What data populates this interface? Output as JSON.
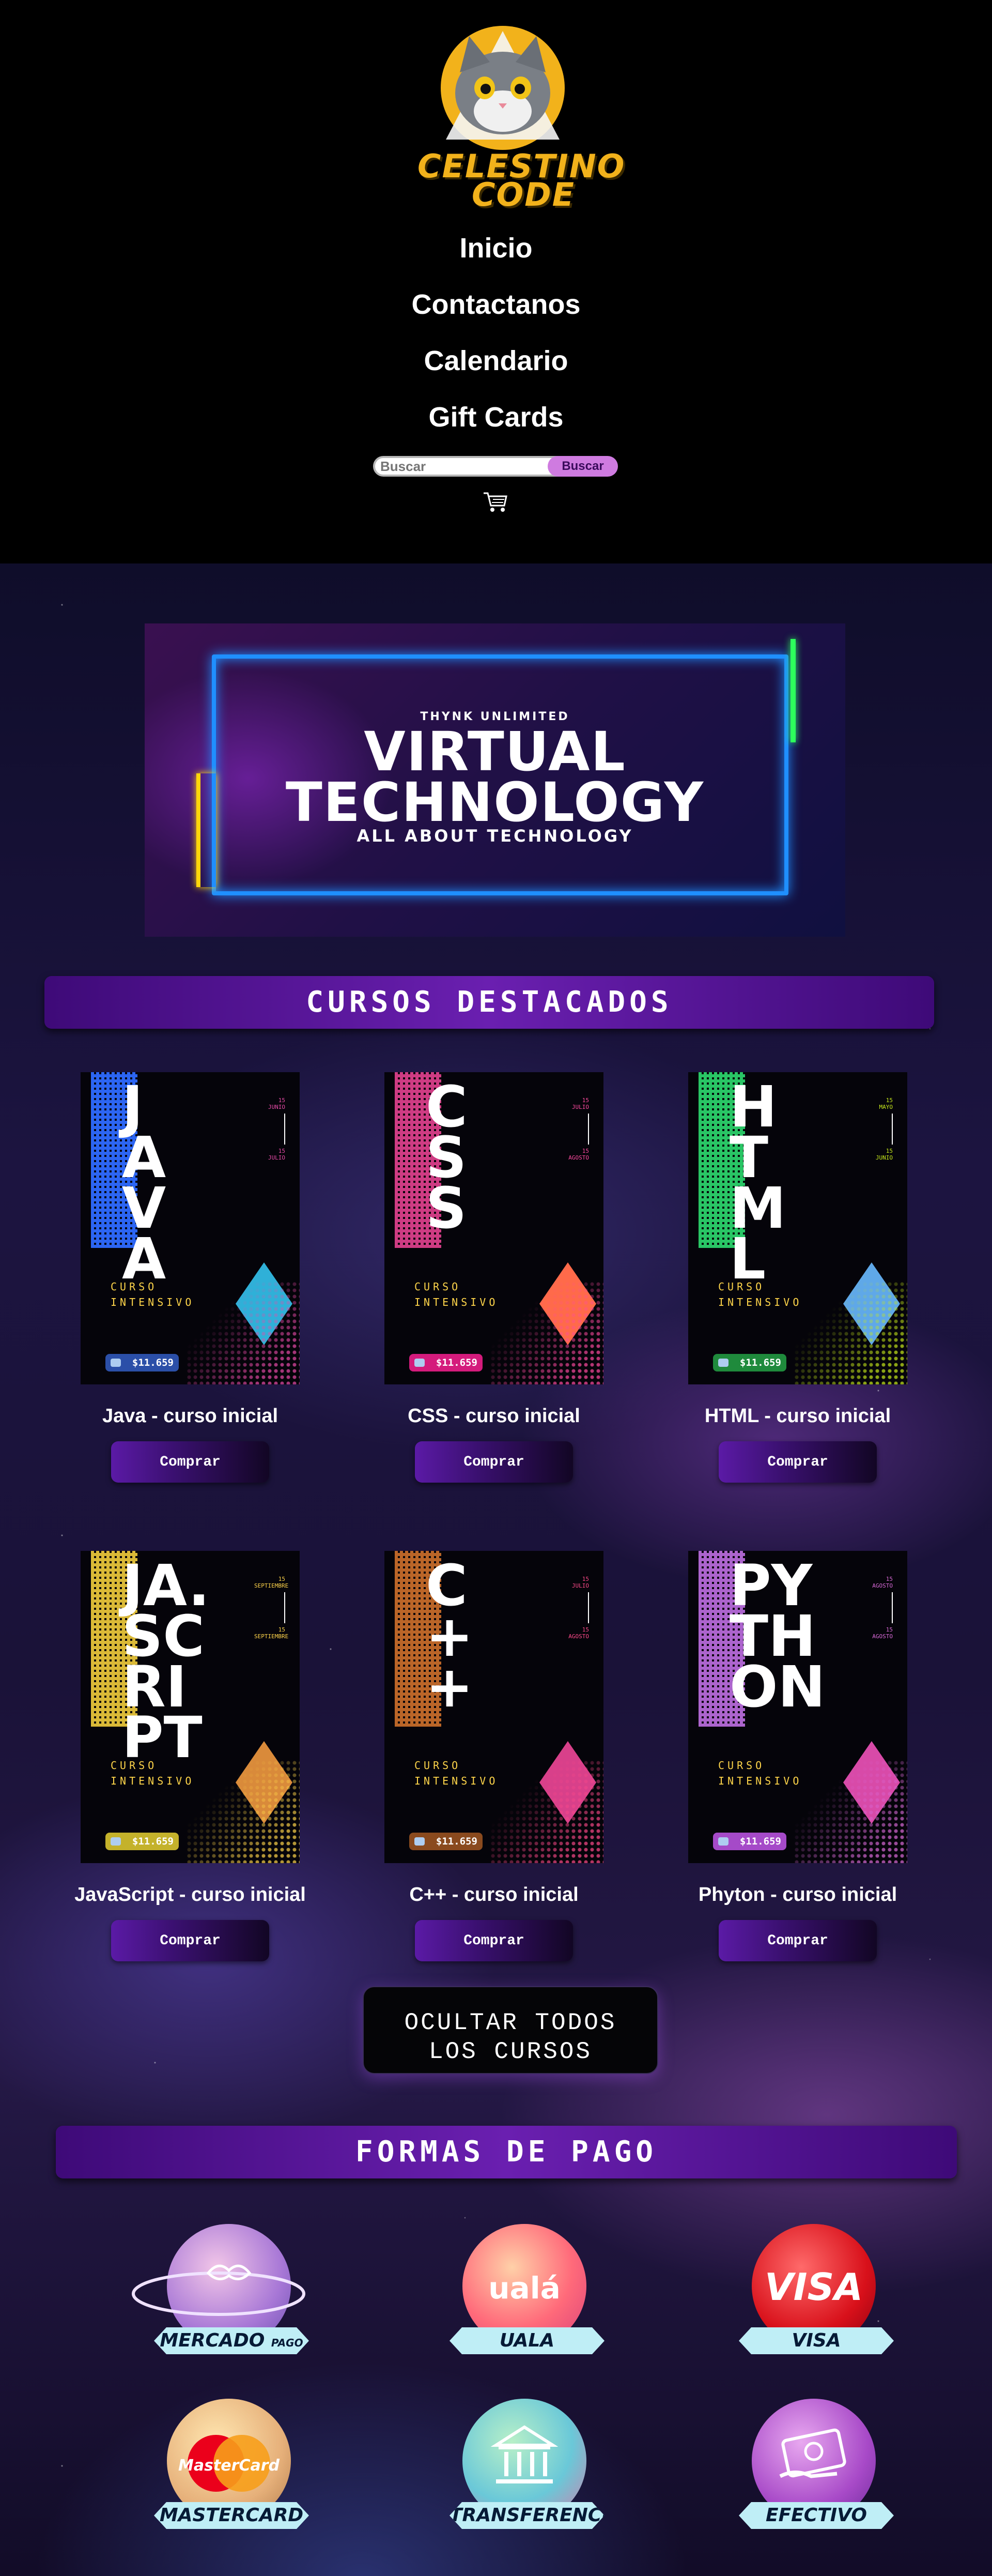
{
  "header": {
    "logo_line1": "CELESTINO",
    "logo_line2": "CODE",
    "nav": [
      "Inicio",
      "Contactanos",
      "Calendario",
      "Gift Cards"
    ],
    "search": {
      "placeholder": "Buscar",
      "button": "Buscar"
    },
    "cart_icon": "cart-icon"
  },
  "banner": {
    "kicker": "THYNK UNLIMITED",
    "title_line1": "VIRTUAL",
    "title_line2": "TECHNOLOGY",
    "subtitle": "ALL ABOUT TECHNOLOGY"
  },
  "featured": {
    "title": "CURSOS DESTACADOS",
    "curso_label": "CURSO",
    "intensivo_label": "INTENSIVO",
    "buy_label": "Comprar",
    "courses": [
      {
        "word": [
          "J",
          "A",
          "V",
          "A"
        ],
        "name": "Java - curso inicial",
        "price": "$11.659",
        "price_color": "#2b4fa8",
        "stripe": "#2f6bff",
        "accent": "#e84ba8",
        "diamond": "#2fb0d8",
        "dates": [
          "15",
          "JUNIO",
          "15",
          "JULIO"
        ]
      },
      {
        "word": [
          "C",
          "S",
          "S"
        ],
        "name": "CSS - curso inicial",
        "price": "$11.659",
        "price_color": "#d41b7c",
        "stripe": "#d9408a",
        "accent": "#ff4aa0",
        "diamond": "#ff6a4a",
        "dates": [
          "15",
          "JULIO",
          "15",
          "AGOSTO"
        ]
      },
      {
        "word": [
          "H",
          "T",
          "M",
          "L"
        ],
        "name": "HTML - curso inicial",
        "price": "$11.659",
        "price_color": "#1f8a3c",
        "stripe": "#2bd06a",
        "accent": "#c6e81b",
        "diamond": "#5fa8e8",
        "dates": [
          "15",
          "MAYO",
          "15",
          "JUNIO"
        ]
      },
      {
        "word": [
          "JA.",
          "SC",
          "RI",
          "PT"
        ],
        "name": "JavaScript - curso inicial",
        "price": "$11.659",
        "price_color": "#c4b22b",
        "stripe": "#e6c33a",
        "accent": "#ffd54a",
        "diamond": "#d98a3a",
        "dates": [
          "15",
          "SEPTIEMBRE",
          "15",
          "SEPTIEMBRE"
        ]
      },
      {
        "word": [
          "C",
          "+",
          "+"
        ],
        "name": "C++ - curso inicial",
        "price": "$11.659",
        "price_color": "#8a4a1e",
        "stripe": "#c46b2a",
        "accent": "#ff4a8a",
        "diamond": "#d8408a",
        "dates": [
          "15",
          "JULIO",
          "15",
          "AGOSTO"
        ]
      },
      {
        "word": [
          "PY",
          "TH",
          "ON"
        ],
        "name": "Phyton - curso inicial",
        "price": "$11.659",
        "price_color": "#a54ac8",
        "stripe": "#b56ad8",
        "accent": "#d96ad8",
        "diamond": "#d84aa8",
        "dates": [
          "15",
          "AGOSTO",
          "15",
          "AGOSTO"
        ]
      }
    ]
  },
  "hide_all": {
    "line1": "OCULTAR TODOS",
    "line2": "LOS CURSOS"
  },
  "payments": {
    "title": "FORMAS DE PAGO",
    "methods": [
      {
        "label": "MERCADO",
        "sub": "PAGO",
        "icon": "handshake-icon"
      },
      {
        "label": "UALA",
        "logo": "ualá",
        "icon": "uala-logo-icon"
      },
      {
        "label": "VISA",
        "logo": "VISA",
        "icon": "visa-logo-icon"
      },
      {
        "label": "MASTERCARD",
        "logo": "MasterCard",
        "icon": "mastercard-logo-icon"
      },
      {
        "label": "TRANSFERENCIA",
        "icon": "bank-icon"
      },
      {
        "label": "EFECTIVO",
        "icon": "cash-icon"
      }
    ]
  }
}
